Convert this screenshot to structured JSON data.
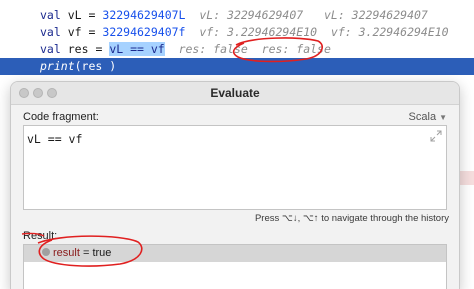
{
  "editor": {
    "lines": [
      {
        "kw": "val",
        "name": "vL",
        "eq": "=",
        "value": "32294629407L",
        "hint1": "vL: 32294629407",
        "hint2": "vL: 32294629407"
      },
      {
        "kw": "val",
        "name": "vf",
        "eq": "=",
        "value": "32294629407f",
        "hint1": "vf: 3.22946294E10",
        "hint2": "vf: 3.22946294E10"
      },
      {
        "kw": "val",
        "name": "res",
        "eq": "=",
        "value": "vL == vf",
        "hint1": "res: false",
        "hint2": "res: false"
      },
      {
        "fn": "print",
        "args": "(res )"
      }
    ]
  },
  "dialog": {
    "title": "Evaluate",
    "code_fragment_label": "Code fragment:",
    "language": "Scala",
    "code": "vL == vf",
    "hint": "Press ⌥↓, ⌥↑ to navigate through the history",
    "result_label": "Result:",
    "result": {
      "name": "result",
      "eq": " = ",
      "value": "true"
    }
  },
  "colors": {
    "selection": "#a6d2ff",
    "current_line": "#2c5eb8",
    "annotation": "#e02020"
  }
}
